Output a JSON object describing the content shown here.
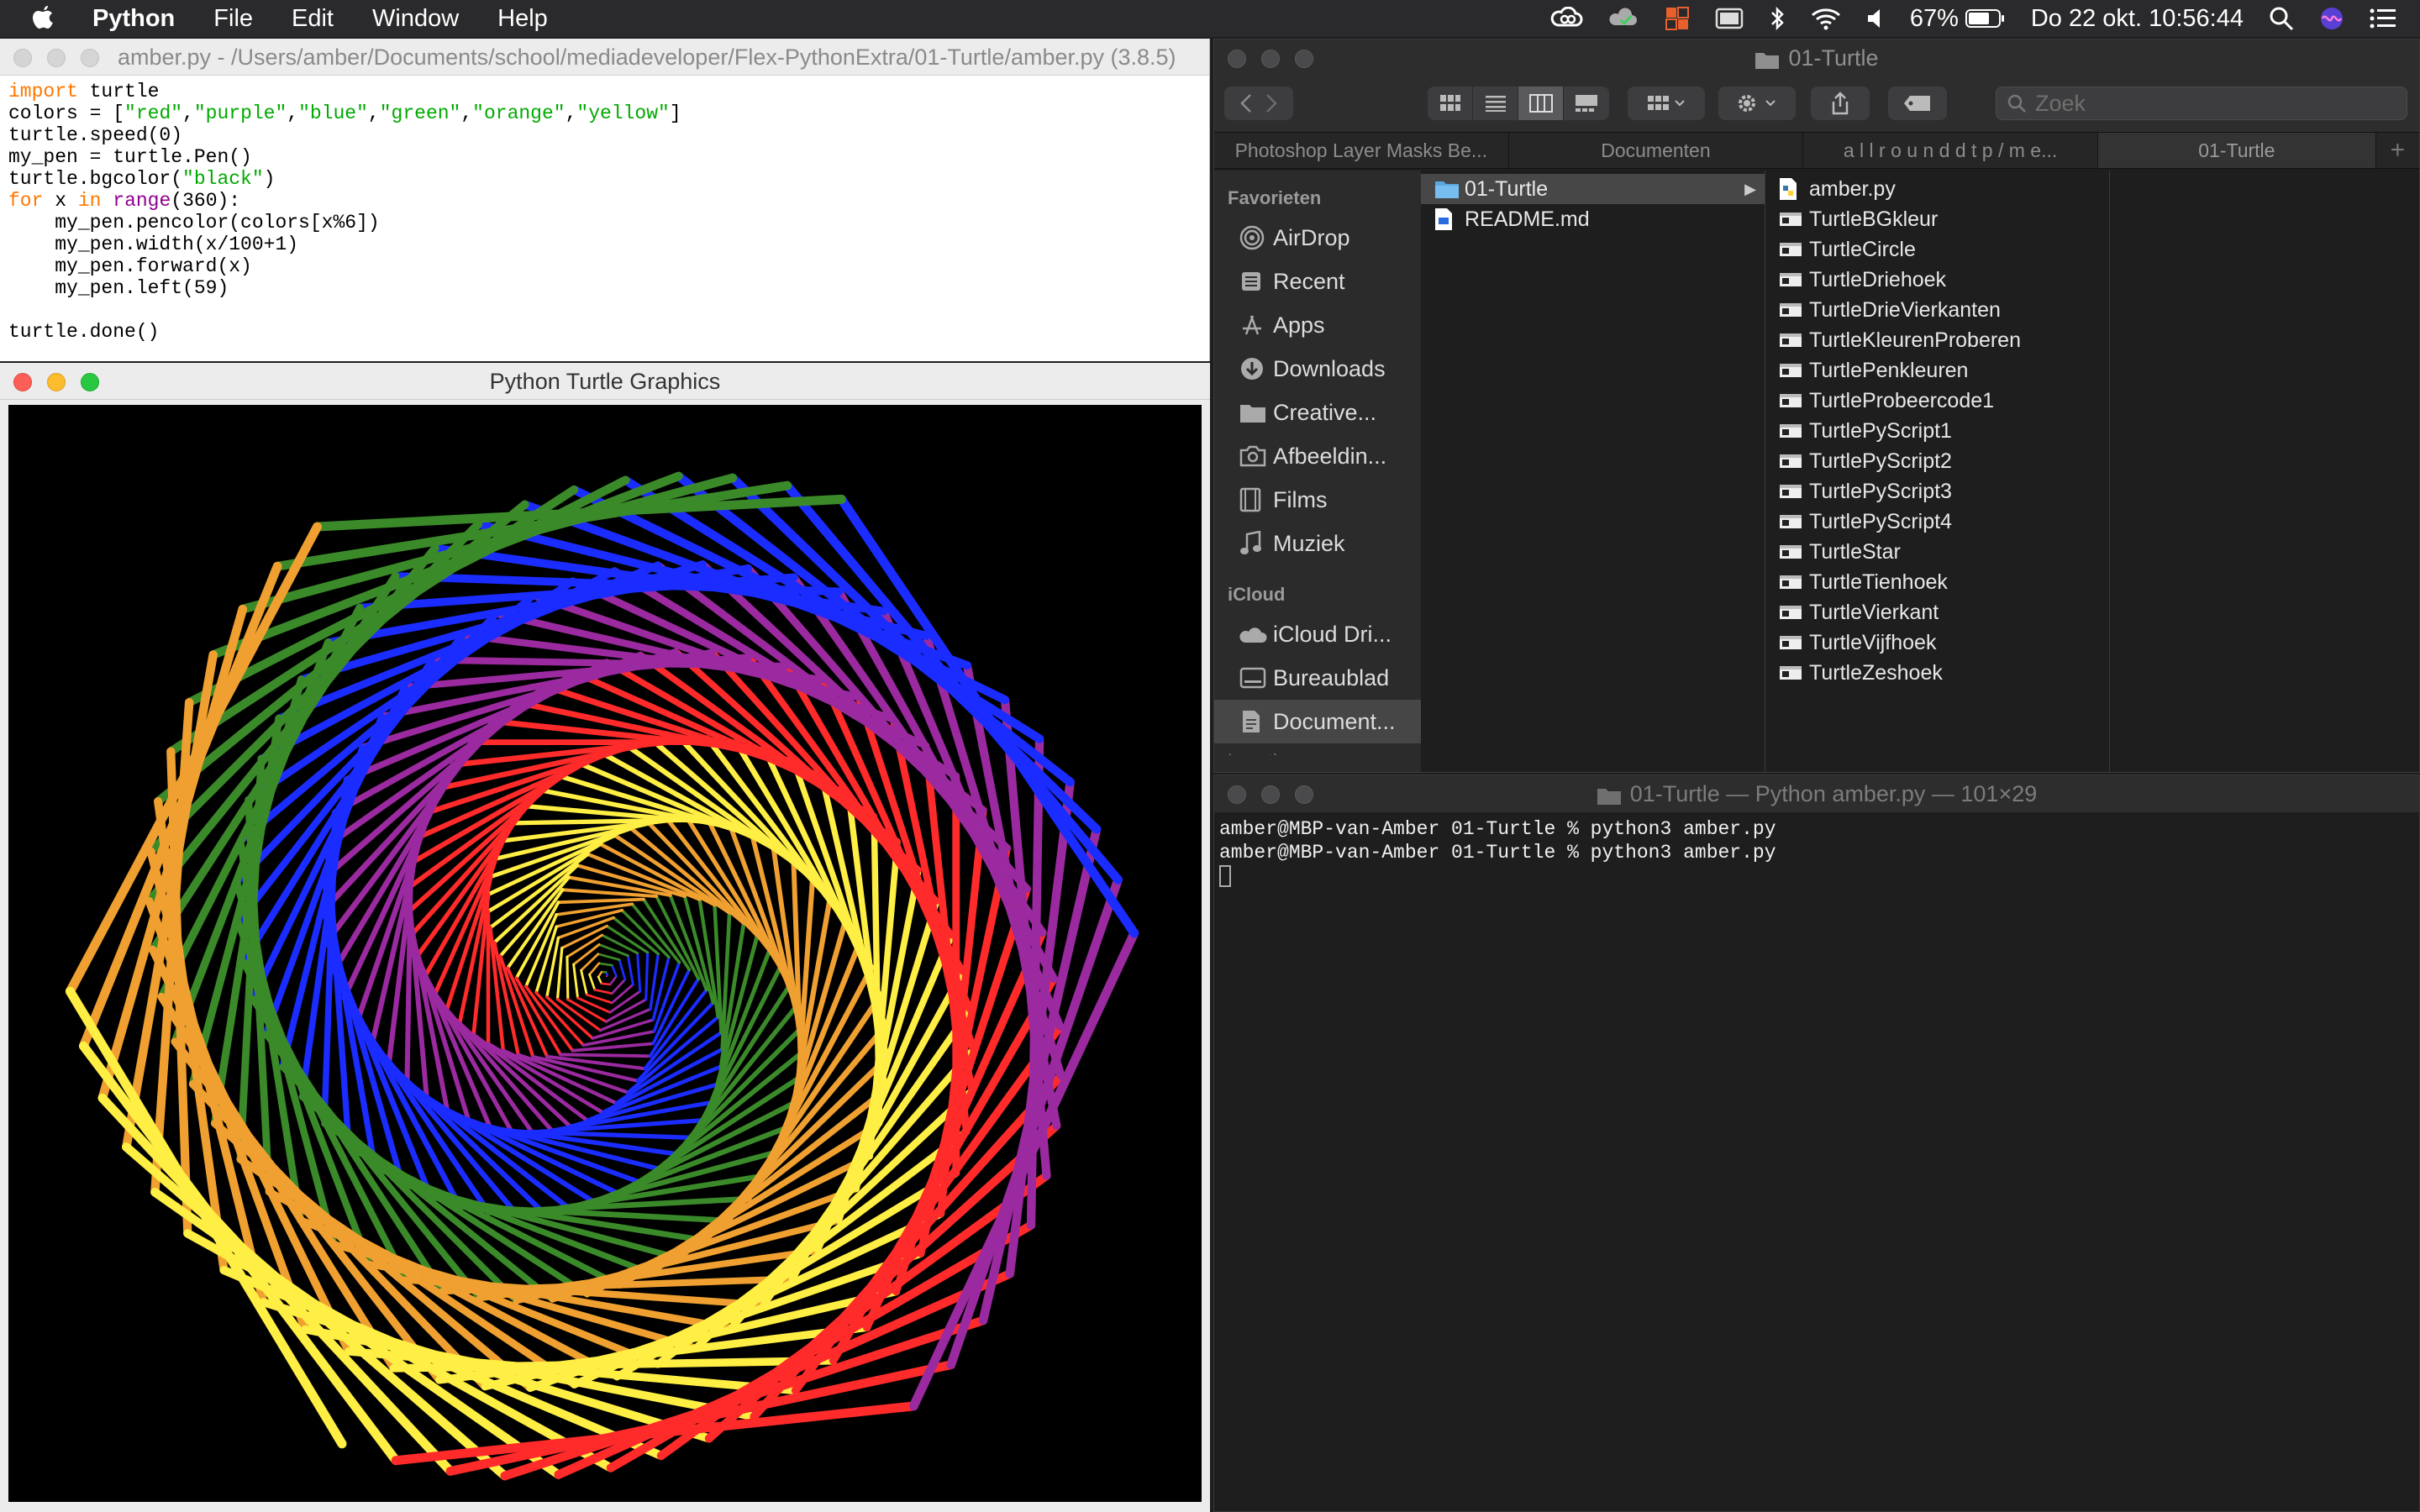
{
  "menubar": {
    "app_name": "Python",
    "menus": [
      "File",
      "Edit",
      "Window",
      "Help"
    ],
    "battery": "67%",
    "datetime": "Do 22 okt.  10:56:44"
  },
  "editor": {
    "title": "amber.py - /Users/amber/Documents/school/mediadeveloper/Flex-PythonExtra/01-Turtle/amber.py (3.8.5)",
    "code": [
      "import turtle",
      "colors = [\"red\",\"purple\",\"blue\",\"green\",\"orange\",\"yellow\"]",
      "turtle.speed(0)",
      "my_pen = turtle.Pen()",
      "turtle.bgcolor(\"black\")",
      "for x in range(360):",
      "    my_pen.pencolor(colors[x%6])",
      "    my_pen.width(x/100+1)",
      "    my_pen.forward(x)",
      "    my_pen.left(59)",
      "",
      "turtle.done()"
    ]
  },
  "turtle_window": {
    "title": "Python Turtle Graphics",
    "drawing": {
      "colors": [
        "#ff2a2a",
        "#9b2aa0",
        "#1a2cff",
        "#3b8a2a",
        "#f0a030",
        "#ffee44"
      ],
      "steps": 360,
      "turn_degrees": 59,
      "background": "#000000"
    }
  },
  "finder": {
    "title": "01-Turtle",
    "search_placeholder": "Zoek",
    "tabs": [
      "Photoshop Layer Masks Be...",
      "Documenten",
      "a l l r o u n d  d t p / m e...",
      "01-Turtle"
    ],
    "sidebar": {
      "favorites_label": "Favorieten",
      "favorites": [
        {
          "label": "AirDrop",
          "icon": "airdrop-icon"
        },
        {
          "label": "Recent",
          "icon": "recent-icon"
        },
        {
          "label": "Apps",
          "icon": "apps-icon"
        },
        {
          "label": "Downloads",
          "icon": "downloads-icon"
        },
        {
          "label": "Creative...",
          "icon": "folder-icon"
        },
        {
          "label": "Afbeeldin...",
          "icon": "camera-icon"
        },
        {
          "label": "Films",
          "icon": "film-icon"
        },
        {
          "label": "Muziek",
          "icon": "music-icon"
        }
      ],
      "icloud_label": "iCloud",
      "icloud": [
        {
          "label": "iCloud Dri...",
          "icon": "cloud-icon"
        },
        {
          "label": "Bureaublad",
          "icon": "desktop-icon"
        },
        {
          "label": "Document...",
          "icon": "document-icon"
        }
      ],
      "cut_label": "Locaties"
    },
    "column1": [
      {
        "name": "01-Turtle",
        "type": "folder"
      },
      {
        "name": "README.md",
        "type": "file"
      }
    ],
    "column2": [
      {
        "name": "amber.py",
        "type": "python"
      },
      {
        "name": "TurtleBGkleur",
        "type": "exec"
      },
      {
        "name": "TurtleCircle",
        "type": "exec"
      },
      {
        "name": "TurtleDriehoek",
        "type": "exec"
      },
      {
        "name": "TurtleDrieVierkanten",
        "type": "exec"
      },
      {
        "name": "TurtleKleurenProberen",
        "type": "exec"
      },
      {
        "name": "TurtlePenkleuren",
        "type": "exec"
      },
      {
        "name": "TurtleProbeercode1",
        "type": "exec"
      },
      {
        "name": "TurtlePyScript1",
        "type": "exec"
      },
      {
        "name": "TurtlePyScript2",
        "type": "exec"
      },
      {
        "name": "TurtlePyScript3",
        "type": "exec"
      },
      {
        "name": "TurtlePyScript4",
        "type": "exec"
      },
      {
        "name": "TurtleStar",
        "type": "exec"
      },
      {
        "name": "TurtleTienhoek",
        "type": "exec"
      },
      {
        "name": "TurtleVierkant",
        "type": "exec"
      },
      {
        "name": "TurtleVijfhoek",
        "type": "exec"
      },
      {
        "name": "TurtleZeshoek",
        "type": "exec"
      }
    ]
  },
  "terminal": {
    "title": "01-Turtle — Python amber.py — 101×29",
    "lines": [
      "amber@MBP-van-Amber 01-Turtle % python3 amber.py",
      "amber@MBP-van-Amber 01-Turtle % python3 amber.py"
    ]
  }
}
